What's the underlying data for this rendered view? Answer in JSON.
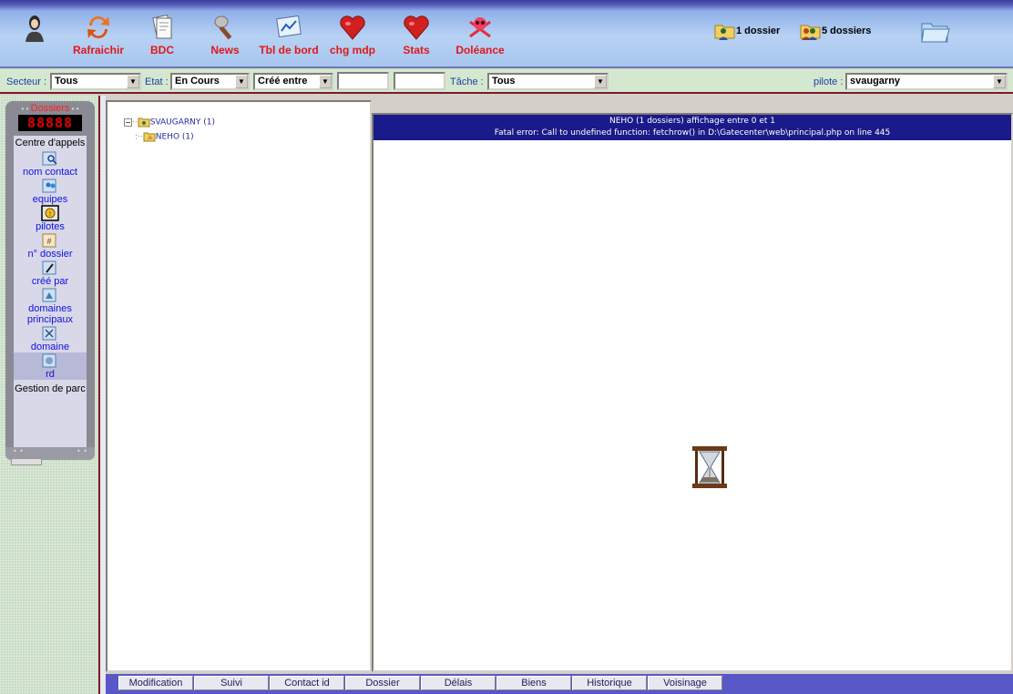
{
  "toolbar": {
    "buttons": [
      {
        "label": "Rafraichir",
        "icon": "refresh-icon"
      },
      {
        "label": "BDC",
        "icon": "document-icon"
      },
      {
        "label": "News",
        "icon": "microphone-icon"
      },
      {
        "label": "Tbl de bord",
        "icon": "dashboard-icon"
      },
      {
        "label": "chg mdp",
        "icon": "heart-icon"
      },
      {
        "label": "Stats",
        "icon": "heart-icon"
      },
      {
        "label": "Doléance",
        "icon": "skull-icon"
      }
    ],
    "right": {
      "one_folder": "1 dossier",
      "five_folders": "5 dossiers"
    }
  },
  "filters": {
    "secteur_label": "Secteur :",
    "secteur_value": "Tous",
    "etat_label": "Etat :",
    "etat_value": "En Cours",
    "date_mode": "Créé entre",
    "tache_label": "Tâche :",
    "tache_value": "Tous",
    "pilote_label": "pilote :",
    "pilote_value": "svaugarny"
  },
  "sidebar": {
    "title": "Dossiers",
    "counter": "88888",
    "group_head": "Centre d'appels",
    "items": [
      {
        "label": "nom contact",
        "icon": "contact-search-icon"
      },
      {
        "label": "equipes",
        "icon": "team-icon"
      },
      {
        "label": "pilotes",
        "icon": "pilot-icon"
      },
      {
        "label": "n° dossier",
        "icon": "folder-number-icon"
      },
      {
        "label": "créé par",
        "icon": "creator-icon"
      },
      {
        "label": "domaines principaux",
        "icon": "main-domains-icon"
      },
      {
        "label": "domaine",
        "icon": "domain-icon"
      },
      {
        "label": "rd",
        "icon": "rd-icon"
      }
    ],
    "footer_group": "Gestion de parc"
  },
  "tree": {
    "root": "SVAUGARNY (1)",
    "child": "NEHO (1)"
  },
  "main": {
    "header_line1": "NEHO (1 dossiers) affichage entre 0 et 1",
    "header_line2": "Fatal error: Call to undefined function: fetchrow() in D:\\Gatecenter\\web\\principal.php on line 445"
  },
  "tabs": [
    "Modification",
    "Suivi",
    "Contact id",
    "Dossier",
    "Délais",
    "Biens",
    "Historique",
    "Voisinage"
  ],
  "colors": {
    "toolbar_label": "#e01818",
    "header_bg": "#1a1a8a",
    "tabbar_bg": "#5858c8"
  }
}
